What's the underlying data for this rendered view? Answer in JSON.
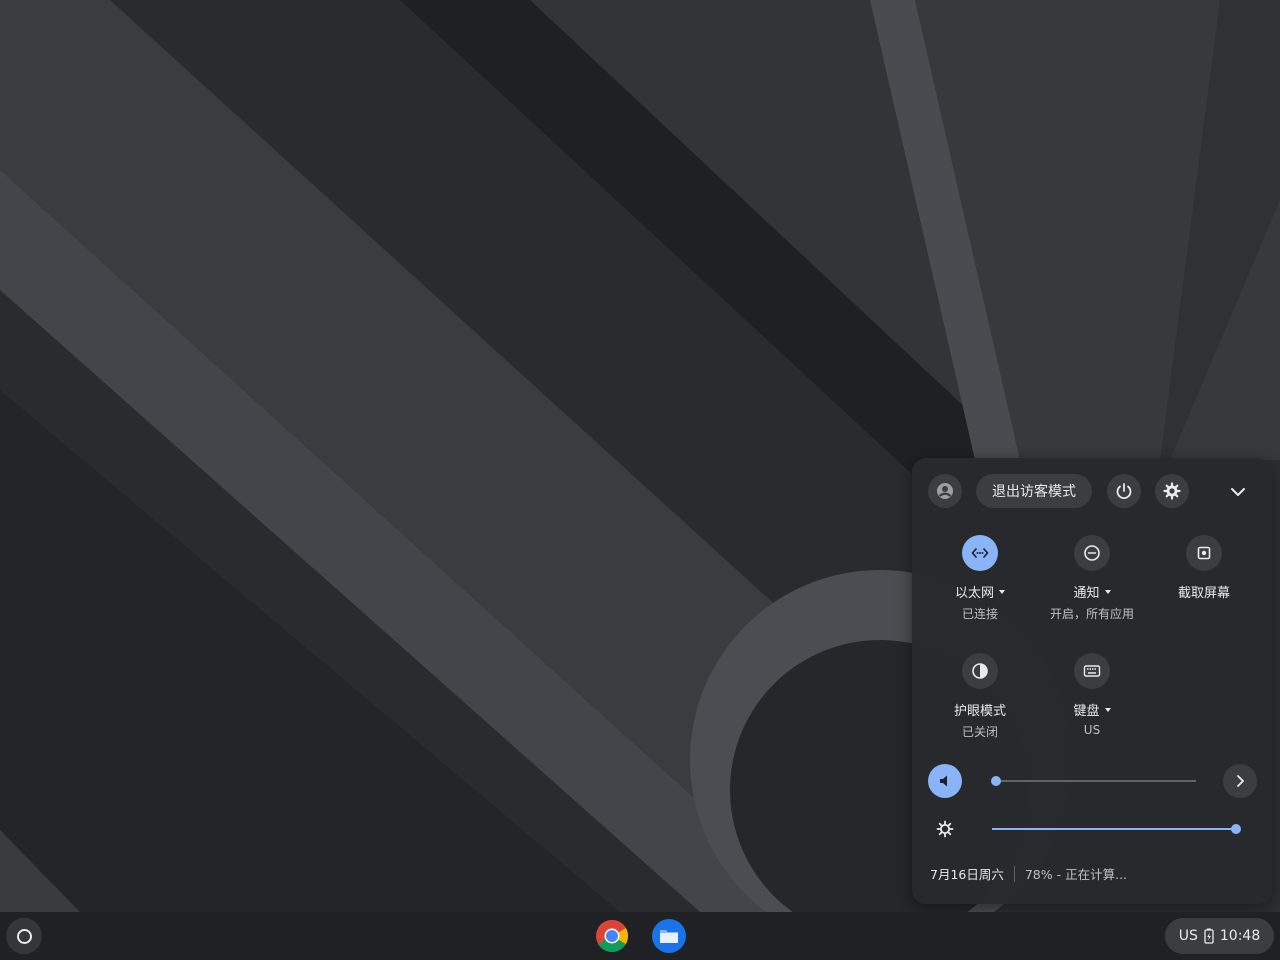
{
  "colors": {
    "accent": "#8ab4f8",
    "panel": "#28292c",
    "button": "#3c3d41",
    "shelf": "#202124"
  },
  "header": {
    "avatar_icon": "account-circle-icon",
    "exit_guest_label": "退出访客模式",
    "power_icon": "power-icon",
    "settings_icon": "gear-icon",
    "collapse_icon": "chevron-down-icon"
  },
  "tiles": [
    {
      "name": "ethernet",
      "icon": "ethernet-icon",
      "label": "以太网",
      "sublabel": "已连接",
      "active": true,
      "has_menu": true
    },
    {
      "name": "notifications",
      "icon": "do-not-disturb-icon",
      "label": "通知",
      "sublabel": "开启，所有应用",
      "active": false,
      "has_menu": true
    },
    {
      "name": "screen-capture",
      "icon": "screen-capture-icon",
      "label": "截取屏幕",
      "sublabel": "",
      "active": false,
      "has_menu": false
    },
    {
      "name": "night-light",
      "icon": "night-light-icon",
      "label": "护眼模式",
      "sublabel": "已关闭",
      "active": false,
      "has_menu": false
    },
    {
      "name": "keyboard",
      "icon": "keyboard-icon",
      "label": "键盘",
      "sublabel": "US",
      "active": false,
      "has_menu": true
    }
  ],
  "sliders": {
    "volume": {
      "icon": "volume-icon",
      "level": 0.0,
      "more_icon": "chevron-right-icon"
    },
    "brightness": {
      "icon": "brightness-icon",
      "level": 1.0
    }
  },
  "footer": {
    "date": "7月16日周六",
    "battery": "78% - 正在计算..."
  },
  "shelf": {
    "launcher_icon": "launcher-icon",
    "apps": [
      {
        "name": "chrome",
        "icon": "chrome-icon"
      },
      {
        "name": "files",
        "icon": "files-icon"
      }
    ],
    "tray": {
      "ime": "US",
      "battery_icon": "battery-charging-icon",
      "time": "10:48"
    }
  }
}
